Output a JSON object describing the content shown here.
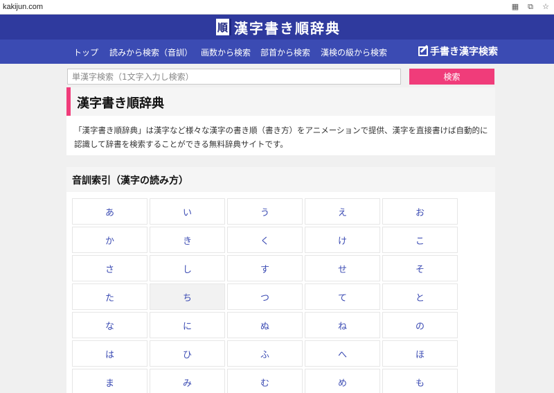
{
  "browser": {
    "url": "kakijun.com",
    "icons": [
      "qr-icon",
      "translate-icon",
      "star-icon"
    ]
  },
  "header": {
    "logo_mark": "順",
    "logo_text": "漢字書き順辞典"
  },
  "nav": {
    "items": [
      "トップ",
      "読みから検索（音訓）",
      "画数から検索",
      "部首から検索",
      "漢検の級から検索"
    ],
    "handwriting": "手書き漢字検索"
  },
  "search": {
    "placeholder": "単漢字検索（1文字入力し検索）",
    "button": "検索"
  },
  "intro": {
    "title": "漢字書き順辞典",
    "description": "「漢字書き順辞典」は漢字など様々な漢字の書き順（書き方）をアニメーションで提供、漢字を直接書けば自動的に認識して辞書を検索することができる無料辞典サイトです。"
  },
  "index": {
    "title": "音訓索引（漢字の読み方）",
    "kana": [
      "あ",
      "い",
      "う",
      "え",
      "お",
      "か",
      "き",
      "く",
      "け",
      "こ",
      "さ",
      "し",
      "す",
      "せ",
      "そ",
      "た",
      "ち",
      "つ",
      "て",
      "と",
      "な",
      "に",
      "ぬ",
      "ね",
      "の",
      "は",
      "ひ",
      "ふ",
      "へ",
      "ほ",
      "ま",
      "み",
      "む",
      "め",
      "も"
    ],
    "hovered": "ち"
  },
  "colors": {
    "header": "#2f3a9e",
    "nav": "#3b4bb3",
    "accent": "#f03c7a"
  }
}
